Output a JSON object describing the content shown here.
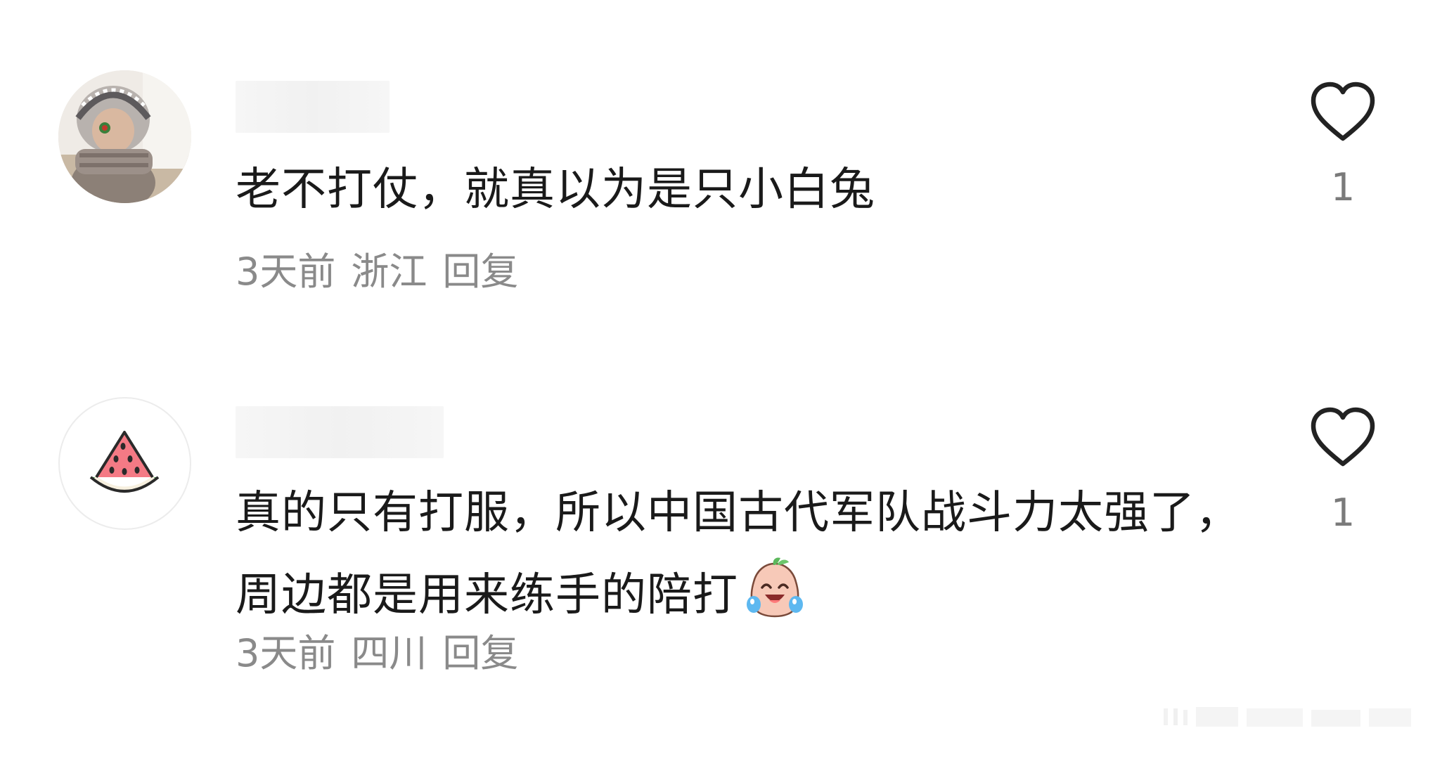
{
  "comments": [
    {
      "text": "老不打仗，就真以为是只小白兔",
      "time": "3天前",
      "location": "浙江",
      "reply_label": "回复",
      "like_count": "1",
      "avatar": "child-photo-avatar"
    },
    {
      "text": "真的只有打服，所以中国古代军队战斗力太强了，周边都是用来练手的陪打",
      "time": "3天前",
      "location": "四川",
      "reply_label": "回复",
      "like_count": "1",
      "avatar": "watermelon-avatar",
      "emoji": "laugh-cry-peach-emoji"
    }
  ],
  "icons": {
    "like": "heart-outline-icon"
  },
  "colors": {
    "text": "#1a1a1a",
    "meta": "#8a8a8a",
    "like_count": "#7a7a7a"
  }
}
